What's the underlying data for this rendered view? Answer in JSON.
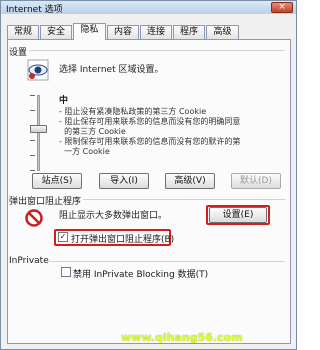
{
  "window": {
    "title": "Internet 选项",
    "close_glyph": "×"
  },
  "tabs": [
    "常规",
    "安全",
    "隐私",
    "内容",
    "连接",
    "程序",
    "高级"
  ],
  "settings": {
    "group_label": "设置",
    "instruction": "选择 Internet 区域设置。",
    "level": "中",
    "bullets": [
      "- 阻止没有紧凑隐私政策的第三方 Cookie",
      "- 阻止保存可用来联系您的信息而没有您的明确同意",
      "  的第三方 Cookie",
      "- 限制保存可用来联系您的信息而没有您的默许的第",
      "  一方 Cookie"
    ],
    "buttons": {
      "sites": "站点(S)",
      "import": "导入(I)",
      "advanced": "高级(V)",
      "default": "默认(D)"
    }
  },
  "popup_blocker": {
    "group_label": "弹出窗口阻止程序",
    "description": "阻止显示大多数弹出窗口。",
    "settings_button": "设置(E)",
    "checkbox_label": "打开弹出窗口阻止程序(B)",
    "checkbox_checked": true
  },
  "inprivate": {
    "group_label": "InPrivate",
    "checkbox_label": "禁用 InPrivate Blocking 数据(T)",
    "checkbox_checked": false
  },
  "watermark": "www.qihang56.com",
  "colors": {
    "highlight": "#d21e1e",
    "watermark": "#d5ff2e"
  }
}
